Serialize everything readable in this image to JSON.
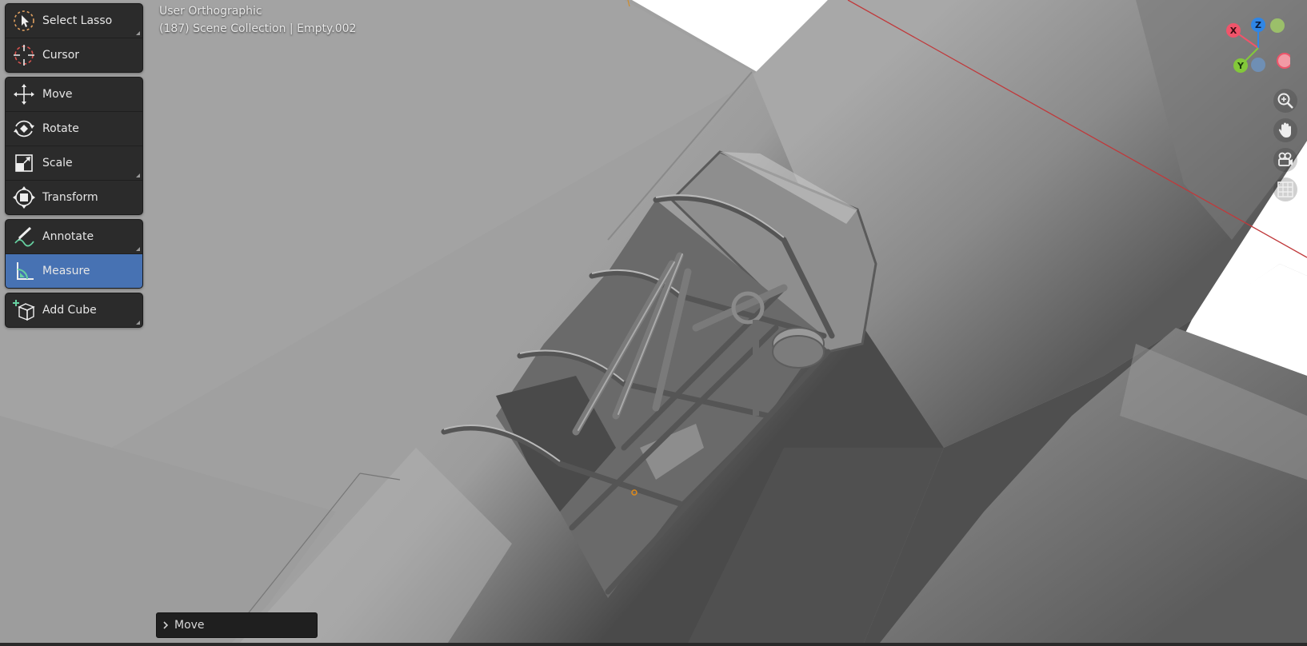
{
  "viewport": {
    "view_name": "User Orthographic",
    "scene_info": "(187) Scene Collection | Empty.002"
  },
  "toolbar": {
    "groups": [
      [
        {
          "label": "Select Lasso",
          "icon": "select-lasso-icon",
          "has_submenu": true
        },
        {
          "label": "Cursor",
          "icon": "cursor-icon",
          "has_submenu": false
        }
      ],
      [
        {
          "label": "Move",
          "icon": "move-icon",
          "has_submenu": false
        },
        {
          "label": "Rotate",
          "icon": "rotate-icon",
          "has_submenu": false
        },
        {
          "label": "Scale",
          "icon": "scale-icon",
          "has_submenu": true
        },
        {
          "label": "Transform",
          "icon": "transform-icon",
          "has_submenu": false
        }
      ],
      [
        {
          "label": "Annotate",
          "icon": "annotate-icon",
          "has_submenu": true
        },
        {
          "label": "Measure",
          "icon": "measure-icon",
          "has_submenu": false,
          "active": true
        }
      ],
      [
        {
          "label": "Add Cube",
          "icon": "add-cube-icon",
          "has_submenu": true
        }
      ]
    ]
  },
  "gizmo": {
    "x_label": "X",
    "y_label": "Y",
    "z_label": "Z",
    "x_color": "#f0546a",
    "y_color": "#83c83a",
    "z_color": "#2f86e6"
  },
  "nav_buttons": [
    "zoom-icon",
    "pan-hand-icon",
    "camera-icon",
    "grid-icon"
  ],
  "last_operator": {
    "label": "Move"
  },
  "colors": {
    "active_tool": "#4772b3",
    "panel_bg": "#2b2b2b"
  }
}
